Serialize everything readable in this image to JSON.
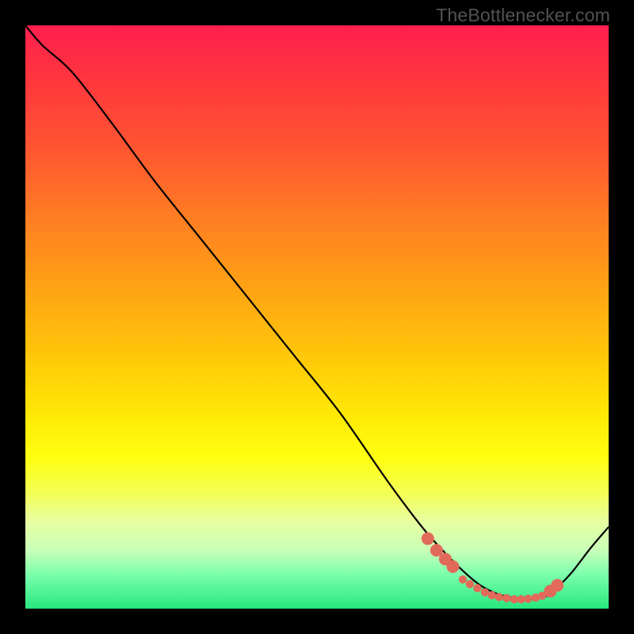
{
  "watermark": "TheBottlenecker.com",
  "colors": {
    "background": "#000000",
    "gradient_top": "#ff1f4f",
    "gradient_bottom": "#27e77e",
    "curve": "#000000",
    "marker": "#e26a5a"
  },
  "chart_data": {
    "type": "line",
    "title": "",
    "xlabel": "",
    "ylabel": "",
    "xlim": [
      0,
      1
    ],
    "ylim": [
      0,
      1
    ],
    "note": "Axes are unitless; values are normalized to the visible plot area (0 = bottom-left, 1 = top-right of the gradient rectangle). Curve is read off the image.",
    "series": [
      {
        "name": "bottleneck-curve",
        "x": [
          0.0,
          0.03,
          0.08,
          0.15,
          0.22,
          0.3,
          0.38,
          0.46,
          0.54,
          0.62,
          0.68,
          0.72,
          0.75,
          0.78,
          0.81,
          0.84,
          0.865,
          0.89,
          0.905,
          0.935,
          0.97,
          1.0
        ],
        "y": [
          1.0,
          0.965,
          0.92,
          0.83,
          0.735,
          0.635,
          0.535,
          0.435,
          0.335,
          0.22,
          0.14,
          0.095,
          0.065,
          0.04,
          0.025,
          0.018,
          0.016,
          0.02,
          0.03,
          0.06,
          0.105,
          0.14
        ]
      }
    ],
    "markers": {
      "name": "highlighted-points",
      "points_r_big": [
        {
          "x": 0.69,
          "y": 0.12
        },
        {
          "x": 0.705,
          "y": 0.1
        },
        {
          "x": 0.72,
          "y": 0.085
        },
        {
          "x": 0.733,
          "y": 0.072
        },
        {
          "x": 0.9,
          "y": 0.03
        },
        {
          "x": 0.912,
          "y": 0.04
        }
      ],
      "points_r_small": [
        {
          "x": 0.75,
          "y": 0.05
        },
        {
          "x": 0.762,
          "y": 0.042
        },
        {
          "x": 0.775,
          "y": 0.035
        },
        {
          "x": 0.788,
          "y": 0.028
        },
        {
          "x": 0.8,
          "y": 0.023
        },
        {
          "x": 0.812,
          "y": 0.02
        },
        {
          "x": 0.825,
          "y": 0.018
        },
        {
          "x": 0.838,
          "y": 0.016
        },
        {
          "x": 0.85,
          "y": 0.016
        },
        {
          "x": 0.862,
          "y": 0.017
        },
        {
          "x": 0.875,
          "y": 0.019
        },
        {
          "x": 0.886,
          "y": 0.022
        }
      ]
    }
  }
}
